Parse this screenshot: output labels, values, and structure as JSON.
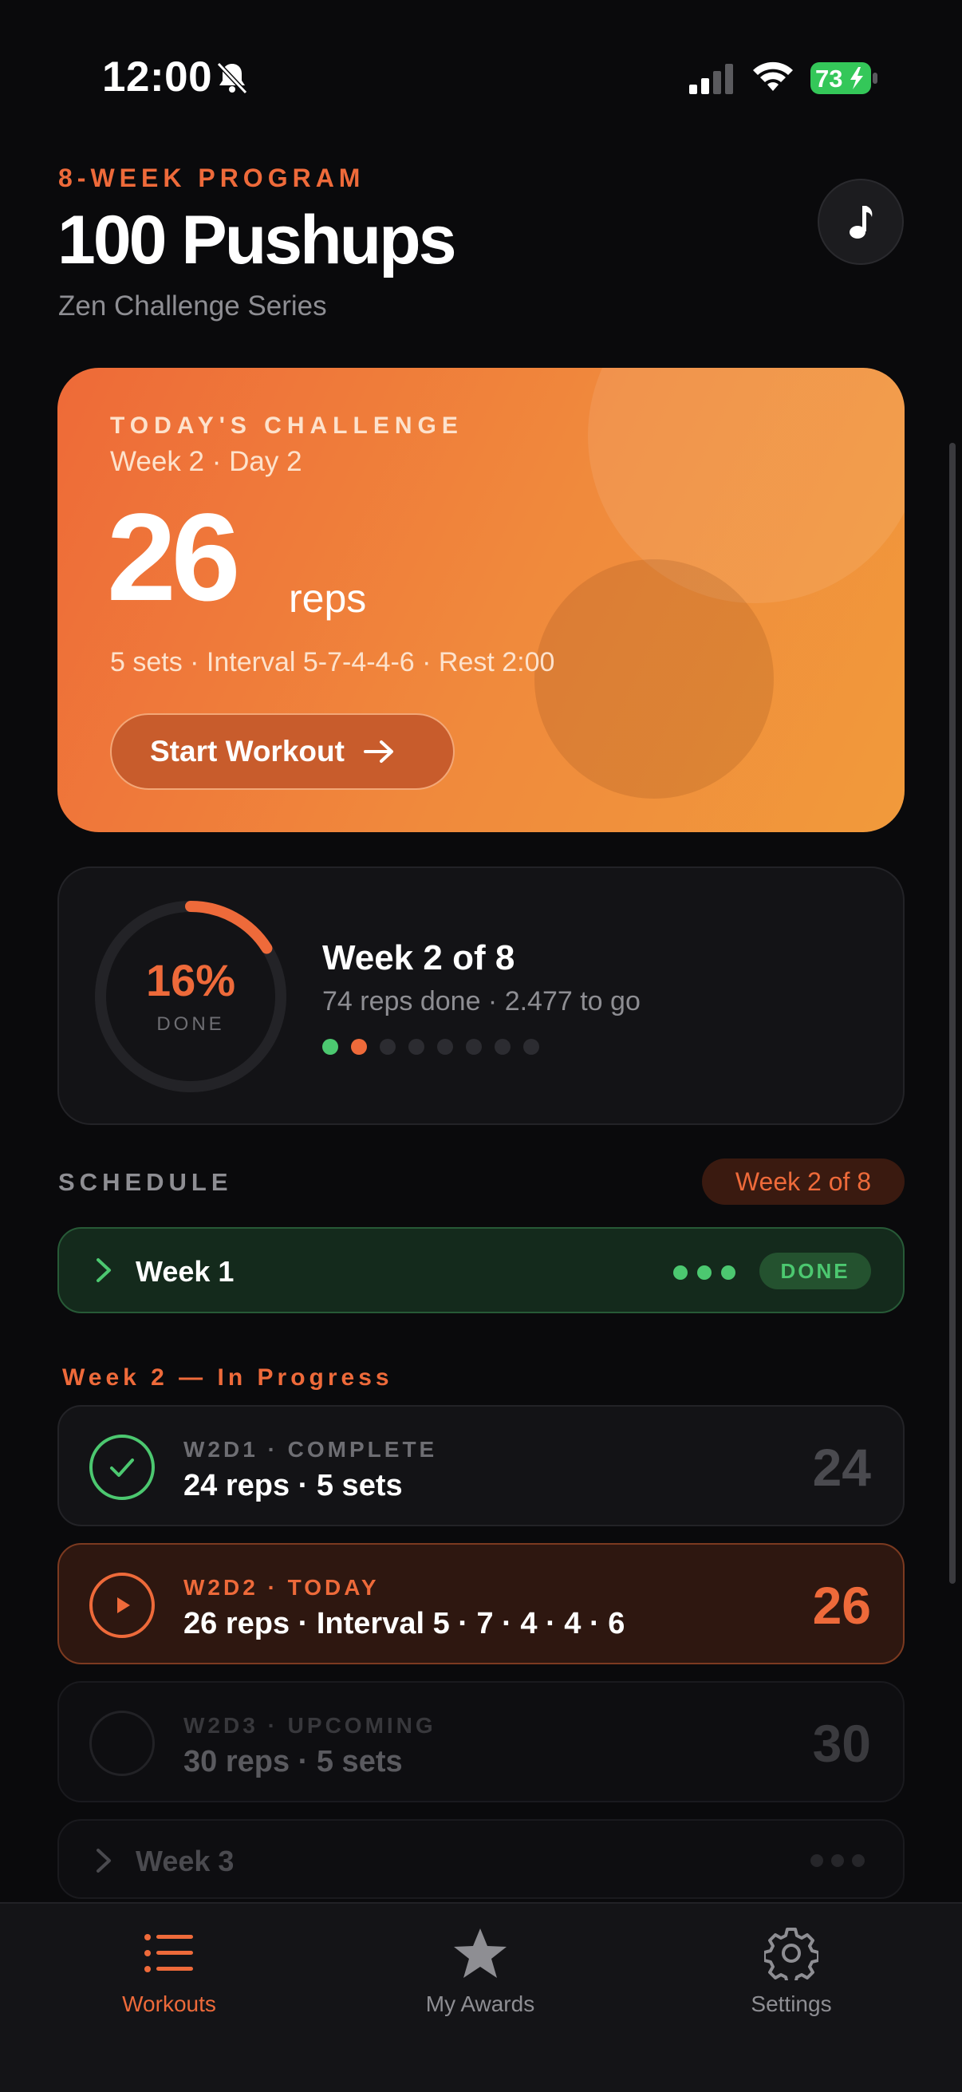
{
  "status_bar": {
    "time": "12:00",
    "battery": "73",
    "icons": [
      "bell-slash-icon",
      "signal-icon",
      "wifi-icon",
      "battery-charging-icon"
    ]
  },
  "header": {
    "eyebrow": "8-WEEK PROGRAM",
    "title": "100 Pushups",
    "subtitle": "Zen Challenge Series",
    "music_icon": "music-note-icon"
  },
  "challenge": {
    "eyebrow": "TODAY'S CHALLENGE",
    "week_day": "Week 2 · Day 2",
    "reps": "26",
    "reps_unit": "reps",
    "meta": "5 sets · Interval 5-7-4-4-6 · Rest 2:00",
    "start_label": "Start Workout"
  },
  "progress": {
    "percent_label": "16%",
    "percent_value": 0.16,
    "done_label": "DONE",
    "title": "Week 2 of 8",
    "subtitle": "74 reps done · 2.477 to go",
    "week_dots": [
      "complete",
      "current",
      "upcoming",
      "upcoming",
      "upcoming",
      "upcoming",
      "upcoming",
      "upcoming"
    ]
  },
  "schedule": {
    "label": "SCHEDULE",
    "badge": "Week 2 of 8",
    "week1": {
      "label": "Week 1",
      "status": "DONE"
    },
    "week2_heading": "Week 2 — In Progress",
    "days": [
      {
        "tag": "W2D1 · COMPLETE",
        "desc": "24 reps · 5 sets",
        "number": "24",
        "state": "complete"
      },
      {
        "tag": "W2D2 · TODAY",
        "desc": "26 reps · Interval 5 · 7 · 4 · 4 · 6",
        "number": "26",
        "state": "today"
      },
      {
        "tag": "W2D3 · UPCOMING",
        "desc": "30 reps · 5 sets",
        "number": "30",
        "state": "upcoming"
      }
    ],
    "week3": {
      "label": "Week 3"
    }
  },
  "tabbar": {
    "tabs": [
      {
        "label": "Workouts",
        "icon": "list-icon",
        "active": true
      },
      {
        "label": "My Awards",
        "icon": "star-icon",
        "active": false
      },
      {
        "label": "Settings",
        "icon": "gear-icon",
        "active": false
      }
    ]
  },
  "colors": {
    "accent": "#ee6a3a",
    "success": "#4cc870",
    "background": "#0a0a0c",
    "card": "#131316"
  }
}
